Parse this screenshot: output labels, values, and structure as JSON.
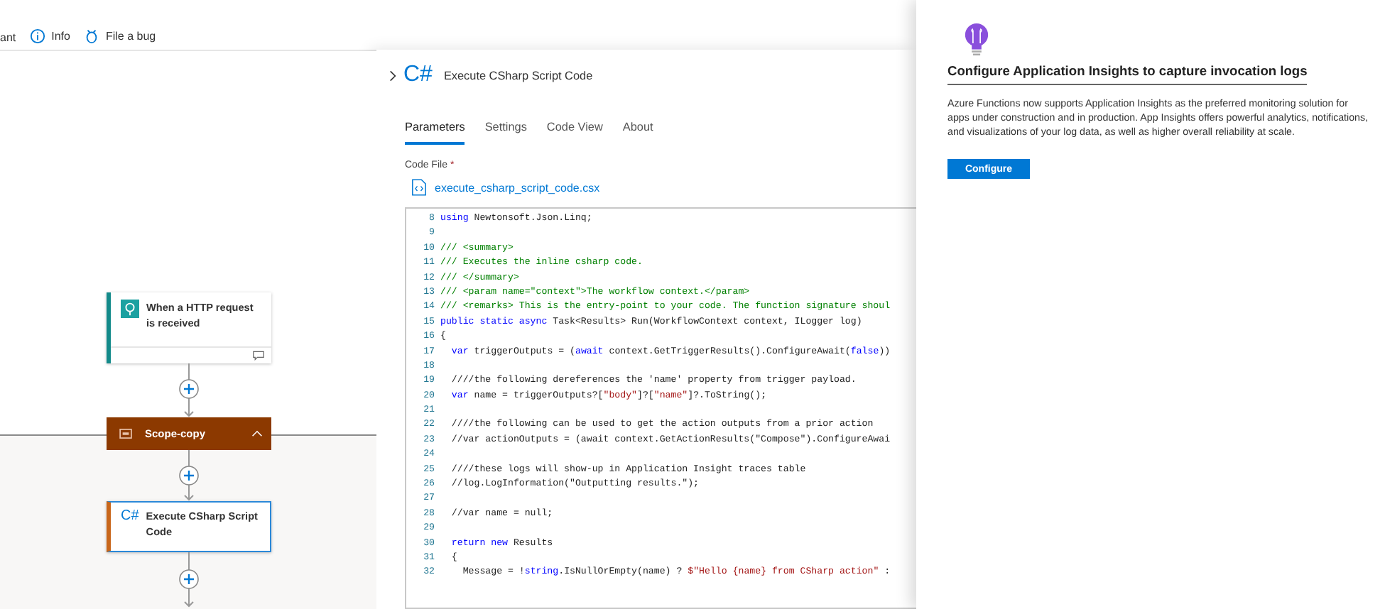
{
  "toolbar": {
    "items": [
      {
        "label": "ant",
        "kind": "plain"
      },
      {
        "label": "Info",
        "kind": "info"
      },
      {
        "label": "File a bug",
        "kind": "bug"
      }
    ]
  },
  "flow": {
    "nodes": [
      {
        "kind": "trigger",
        "title": "When a HTTP request is received"
      },
      {
        "kind": "scope",
        "title": "Scope-copy",
        "expanded": true
      },
      {
        "kind": "action",
        "title": "Execute CSharp Script Code",
        "icon_text": "C#",
        "selected": true
      }
    ]
  },
  "action_panel": {
    "title": "Execute CSharp Script Code",
    "icon_text": "C#",
    "tabs": [
      {
        "label": "Parameters",
        "selected": true
      },
      {
        "label": "Settings",
        "selected": false
      },
      {
        "label": "Code View",
        "selected": false
      },
      {
        "label": "About",
        "selected": false
      }
    ],
    "code_file": {
      "label": "Code File",
      "required_mark": "*",
      "file_name": "execute_csharp_script_code.csx"
    },
    "code": [
      {
        "n": "8",
        "segs": [
          {
            "kind": "kw",
            "text": "using"
          },
          {
            "kind": "tx",
            "text": " Newtonsoft.Json.Linq;"
          }
        ]
      },
      {
        "n": "9"
      },
      {
        "n": "10",
        "segs": [
          {
            "kind": "cm",
            "text": "/// <summary>"
          }
        ]
      },
      {
        "n": "11",
        "segs": [
          {
            "kind": "cm",
            "text": "/// Executes the inline csharp code."
          }
        ]
      },
      {
        "n": "12",
        "segs": [
          {
            "kind": "cm",
            "text": "/// </summary>"
          }
        ]
      },
      {
        "n": "13",
        "segs": [
          {
            "kind": "cm",
            "text": "/// <param name=\"context\">The workflow context.</param>"
          }
        ]
      },
      {
        "n": "14",
        "segs": [
          {
            "kind": "cm",
            "text": "/// <remarks> This is the entry-point to your code. The function signature shoul"
          }
        ]
      },
      {
        "n": "15",
        "segs": [
          {
            "kind": "kw",
            "text": "public static async"
          },
          {
            "kind": "tx",
            "text": " Task<Results> Run(WorkflowContext context, ILogger log)"
          }
        ]
      },
      {
        "n": "16",
        "segs": [
          {
            "kind": "tx",
            "text": "{"
          }
        ]
      },
      {
        "n": "17",
        "segs": [
          {
            "kind": "kw",
            "text": "  var"
          },
          {
            "kind": "tx",
            "text": " triggerOutputs = ("
          },
          {
            "kind": "kw",
            "text": "await"
          },
          {
            "kind": "tx",
            "text": " context.GetTriggerResults().ConfigureAwait("
          },
          {
            "kind": "kw",
            "text": "false"
          },
          {
            "kind": "tx",
            "text": "))"
          }
        ]
      },
      {
        "n": "18"
      },
      {
        "n": "19",
        "segs": [
          {
            "kind": "tx",
            "text": "  ////the following dereferences the 'name' property from trigger payload."
          }
        ]
      },
      {
        "n": "20",
        "segs": [
          {
            "kind": "kw",
            "text": "  var"
          },
          {
            "kind": "tx",
            "text": " name = triggerOutputs?["
          },
          {
            "kind": "str",
            "text": "\"body\""
          },
          {
            "kind": "tx",
            "text": "]?["
          },
          {
            "kind": "str",
            "text": "\"name\""
          },
          {
            "kind": "tx",
            "text": "]?.ToString();"
          }
        ]
      },
      {
        "n": "21"
      },
      {
        "n": "22",
        "segs": [
          {
            "kind": "tx",
            "text": "  ////the following can be used to get the action outputs from a prior action"
          }
        ]
      },
      {
        "n": "23",
        "segs": [
          {
            "kind": "tx",
            "text": "  //var actionOutputs = (await context.GetActionResults(\"Compose\").ConfigureAwai"
          }
        ]
      },
      {
        "n": "24"
      },
      {
        "n": "25",
        "segs": [
          {
            "kind": "tx",
            "text": "  ////these logs will show-up in Application Insight traces table"
          }
        ]
      },
      {
        "n": "26",
        "segs": [
          {
            "kind": "tx",
            "text": "  //log.LogInformation(\"Outputting results.\");"
          }
        ]
      },
      {
        "n": "27"
      },
      {
        "n": "28",
        "segs": [
          {
            "kind": "tx",
            "text": "  //var name = null;"
          }
        ]
      },
      {
        "n": "29"
      },
      {
        "n": "30",
        "segs": [
          {
            "kind": "kw",
            "text": "  return new"
          },
          {
            "kind": "tx",
            "text": " Results"
          }
        ]
      },
      {
        "n": "31",
        "segs": [
          {
            "kind": "tx",
            "text": "  {"
          }
        ]
      },
      {
        "n": "32",
        "segs": [
          {
            "kind": "tx",
            "text": "    Message = !"
          },
          {
            "kind": "kw",
            "text": "string"
          },
          {
            "kind": "tx",
            "text": ".IsNullOrEmpty(name) ? "
          },
          {
            "kind": "str",
            "text": "$\"Hello {name} from CSharp action\""
          },
          {
            "kind": "tx",
            "text": " :"
          }
        ]
      }
    ]
  },
  "insights_panel": {
    "title": "Configure Application Insights to capture invocation logs",
    "body": "Azure Functions now supports Application Insights as the preferred monitoring solution for apps under construction and in production. App Insights offers powerful analytics, notifications, and visualizations of your log data, as well as higher overall reliability at scale.",
    "button": "Configure"
  }
}
